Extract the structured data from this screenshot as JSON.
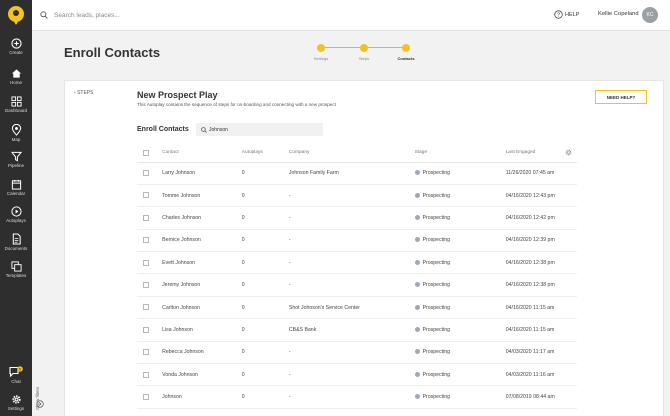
{
  "search": {
    "placeholder": "Search leads, places..."
  },
  "header": {
    "help_label": "HELP",
    "user_name": "Kellie Copeland",
    "user_initials": "KC"
  },
  "sidebar": {
    "items": [
      {
        "label": "Create",
        "icon": "plus-circle-icon"
      },
      {
        "label": "Home",
        "icon": "home-icon"
      },
      {
        "label": "Dashboard",
        "icon": "dashboard-grid-icon"
      },
      {
        "label": "Map",
        "icon": "map-pin-icon"
      },
      {
        "label": "Pipeline",
        "icon": "funnel-icon"
      },
      {
        "label": "Calendar",
        "icon": "calendar-icon"
      },
      {
        "label": "Autoplays",
        "icon": "play-circle-icon"
      },
      {
        "label": "Documents",
        "icon": "document-icon"
      },
      {
        "label": "Templates",
        "icon": "templates-icon"
      },
      {
        "label": "Chat",
        "icon": "chat-icon",
        "badge": "5"
      },
      {
        "label": "Settings",
        "icon": "gear-icon"
      }
    ],
    "show_filters_label": "Show filters"
  },
  "page": {
    "title": "Enroll Contacts",
    "stepper": {
      "steps": [
        {
          "label": "Settings",
          "state": "done"
        },
        {
          "label": "Steps",
          "state": "done"
        },
        {
          "label": "Contacts",
          "state": "active"
        }
      ]
    }
  },
  "card": {
    "back_label": "STEPS",
    "play_title": "New Prospect Play",
    "play_description": "This Autoplay contains the sequence of steps for on-boarding and connecting with a new prospect",
    "need_help_label": "NEED HELP?",
    "enroll_label": "Enroll Contacts",
    "enroll_search_value": "Johnson"
  },
  "table": {
    "headers": {
      "contact": "Contact",
      "autoplays": "Autoplays",
      "company": "Company",
      "stage": "Stage",
      "last_engaged": "Last Engaged"
    },
    "stage_color": "#9fa8b3",
    "rows": [
      {
        "contact": "Larry Johnson",
        "autoplays": "0",
        "company": "Johnson Family Farm",
        "stage": "Prospecting",
        "last_engaged": "11/26/2020 07:45 am"
      },
      {
        "contact": "Tomme Johnson",
        "autoplays": "0",
        "company": "-",
        "stage": "Prospecting",
        "last_engaged": "04/16/2020 12:43 pm"
      },
      {
        "contact": "Charles Johnson",
        "autoplays": "0",
        "company": "-",
        "stage": "Prospecting",
        "last_engaged": "04/16/2020 12:42 pm"
      },
      {
        "contact": "Bernice Johnson",
        "autoplays": "0",
        "company": "-",
        "stage": "Prospecting",
        "last_engaged": "04/16/2020 12:39 pm"
      },
      {
        "contact": "Evett Johnson",
        "autoplays": "0",
        "company": "-",
        "stage": "Prospecting",
        "last_engaged": "04/16/2020 12:38 pm"
      },
      {
        "contact": "Jeremy Johnson",
        "autoplays": "0",
        "company": "-",
        "stage": "Prospecting",
        "last_engaged": "04/16/2020 12:38 pm"
      },
      {
        "contact": "Carlton Johnson",
        "autoplays": "0",
        "company": "Shot Johnson's Service Center",
        "stage": "Prospecting",
        "last_engaged": "04/16/2020 11:15 am"
      },
      {
        "contact": "Lisa Johnson",
        "autoplays": "0",
        "company": "CB&S Bank",
        "stage": "Prospecting",
        "last_engaged": "04/16/2020 11:15 am"
      },
      {
        "contact": "Rebecca Johnson",
        "autoplays": "0",
        "company": "-",
        "stage": "Prospecting",
        "last_engaged": "04/03/2020 11:17 am"
      },
      {
        "contact": "Vonda Johnson",
        "autoplays": "0",
        "company": "-",
        "stage": "Prospecting",
        "last_engaged": "04/03/2020 11:16 am"
      },
      {
        "contact": "Johnson",
        "autoplays": "0",
        "company": "-",
        "stage": "Prospecting",
        "last_engaged": "07/08/2019 08:44 am"
      }
    ]
  },
  "colors": {
    "accent": "#f3c21f",
    "sidebar_bg": "#2e2e2e"
  }
}
